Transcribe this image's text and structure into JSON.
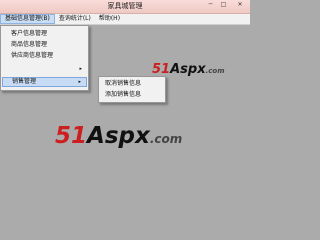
{
  "window": {
    "title": "家具城管理",
    "min_icon": "minimize-icon",
    "max_icon": "maximize-icon",
    "close_icon": "close-icon"
  },
  "menubar": {
    "items": [
      {
        "label": "基础信息管理(B)"
      },
      {
        "label": "查询统计(L)"
      },
      {
        "label": "帮助(H)"
      }
    ]
  },
  "dropdown": {
    "items": [
      {
        "label": "客户信息管理"
      },
      {
        "label": "商品信息管理"
      },
      {
        "label": "供应商信息管理"
      },
      {
        "label": "",
        "arrow": "▸"
      },
      {
        "label": "销售管理",
        "arrow": "▸"
      }
    ]
  },
  "submenu": {
    "items": [
      {
        "label": "取消销售信息"
      },
      {
        "label": "添加销售信息"
      }
    ]
  },
  "watermark": {
    "part1": "51",
    "part2": "Aspx",
    "part3": ".com"
  }
}
